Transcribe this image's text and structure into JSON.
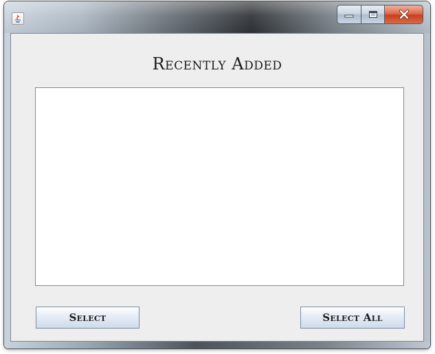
{
  "window": {
    "title": "",
    "icon": "java-cup-icon",
    "controls": {
      "minimize": "minimize-icon",
      "maximize": "maximize-icon",
      "close": "close-icon"
    }
  },
  "main": {
    "heading": "Recently Added",
    "list_items": [],
    "buttons": {
      "select_label": "Select",
      "select_all_label": "Select All"
    }
  },
  "colors": {
    "client_background": "#eeeeee",
    "list_background": "#ffffff",
    "close_button": "#c7401f"
  }
}
